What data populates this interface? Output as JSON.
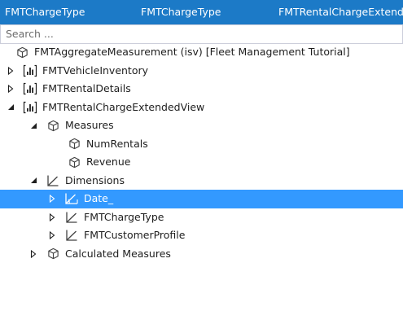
{
  "tabs": [
    {
      "label": "FMTChargeType"
    },
    {
      "label": "FMTChargeType"
    },
    {
      "label": "FMTRentalChargeExtendedView"
    }
  ],
  "search": {
    "placeholder": "Search ..."
  },
  "tree": {
    "root": {
      "label": "FMTAggregateMeasurement (isv) [Fleet Management Tutorial]",
      "icon": "cube-icon"
    },
    "items": [
      {
        "label": "FMTVehicleInventory",
        "icon": "bar-chart-icon",
        "expander": "collapsed"
      },
      {
        "label": "FMTRentalDetails",
        "icon": "bar-chart-icon",
        "expander": "collapsed"
      },
      {
        "label": "FMTRentalChargeExtendedView",
        "icon": "bar-chart-icon",
        "expander": "expanded"
      },
      {
        "label": "Measures",
        "icon": "cube-icon",
        "expander": "expanded"
      },
      {
        "label": "NumRentals",
        "icon": "cube-icon",
        "expander": "none"
      },
      {
        "label": "Revenue",
        "icon": "cube-icon",
        "expander": "none"
      },
      {
        "label": "Dimensions",
        "icon": "axis-icon",
        "expander": "expanded"
      },
      {
        "label": "Date_",
        "icon": "axis-icon",
        "expander": "collapsed",
        "selected": true
      },
      {
        "label": "FMTChargeType",
        "icon": "axis-icon",
        "expander": "collapsed"
      },
      {
        "label": "FMTCustomerProfile",
        "icon": "axis-icon",
        "expander": "collapsed"
      },
      {
        "label": "Calculated Measures",
        "icon": "cube-icon",
        "expander": "collapsed"
      }
    ]
  },
  "colors": {
    "tab_bar": "#1c7ac7",
    "selection": "#3399ff",
    "text": "#1e1e1e"
  }
}
